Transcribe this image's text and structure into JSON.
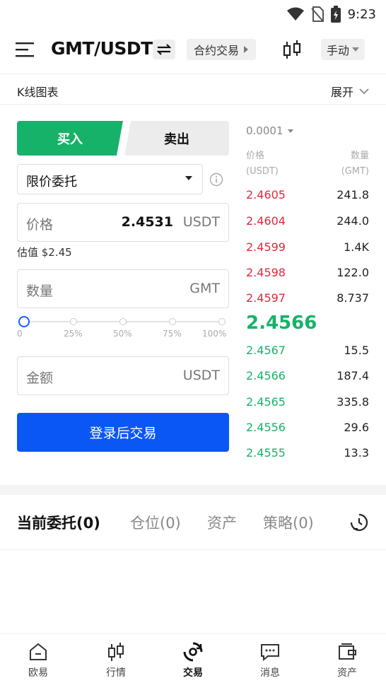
{
  "status": {
    "time": "9:23"
  },
  "header": {
    "pair": "GMT/USDT",
    "contract_label": "合约交易",
    "manual_label": "手动"
  },
  "kline": {
    "title": "K线图表",
    "expand_label": "展开"
  },
  "trade": {
    "buy_label": "买入",
    "sell_label": "卖出",
    "order_type": "限价委托",
    "price_label": "价格",
    "price_value": "2.4531",
    "price_unit": "USDT",
    "estimate": "估值 $2.45",
    "qty_label": "数量",
    "qty_unit": "GMT",
    "amount_label": "金额",
    "amount_unit": "USDT",
    "slider_labels": [
      "0",
      "25%",
      "50%",
      "75%",
      "100%"
    ],
    "slider_value_percent": 0,
    "login_button": "登录后交易"
  },
  "orderbook": {
    "precision": "0.0001",
    "price_header": [
      "价格",
      "(USDT)"
    ],
    "qty_header": [
      "数量",
      "(GMT)"
    ],
    "asks": [
      {
        "price": "2.4605",
        "qty": "241.8"
      },
      {
        "price": "2.4604",
        "qty": "244.0"
      },
      {
        "price": "2.4599",
        "qty": "1.4K"
      },
      {
        "price": "2.4598",
        "qty": "122.0"
      },
      {
        "price": "2.4597",
        "qty": "8.737"
      }
    ],
    "last_price": "2.4566",
    "bids": [
      {
        "price": "2.4567",
        "qty": "15.5"
      },
      {
        "price": "2.4566",
        "qty": "187.4"
      },
      {
        "price": "2.4565",
        "qty": "335.8"
      },
      {
        "price": "2.4556",
        "qty": "29.6"
      },
      {
        "price": "2.4555",
        "qty": "13.3"
      }
    ]
  },
  "positions_tabs": [
    {
      "label": "当前委托(0)",
      "active": true
    },
    {
      "label": "仓位(0)",
      "active": false
    },
    {
      "label": "资产",
      "active": false
    },
    {
      "label": "策略(0)",
      "active": false
    }
  ],
  "nav": [
    {
      "label": "欧易",
      "icon": "home-icon"
    },
    {
      "label": "行情",
      "icon": "candlestick-icon"
    },
    {
      "label": "交易",
      "icon": "trade-icon",
      "active": true
    },
    {
      "label": "消息",
      "icon": "message-icon"
    },
    {
      "label": "资产",
      "icon": "wallet-icon"
    }
  ],
  "colors": {
    "buy": "#17b26a",
    "sell": "#e0293d",
    "primary": "#0b57f5"
  }
}
